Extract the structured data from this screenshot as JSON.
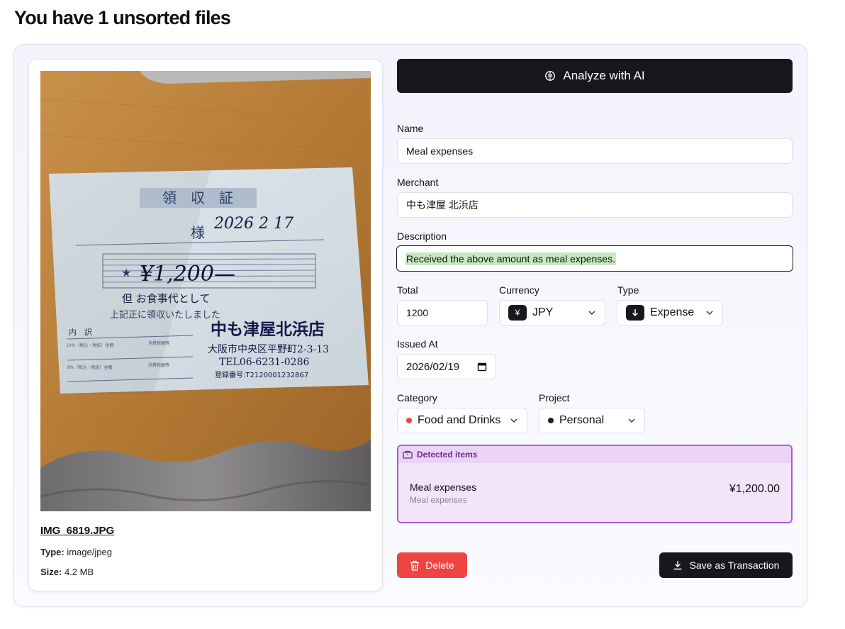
{
  "page": {
    "title": "You have 1 unsorted files"
  },
  "file": {
    "name": "IMG_6819.JPG",
    "type_label": "Type:",
    "type_value": "image/jpeg",
    "size_label": "Size:",
    "size_value": "4.2 MB"
  },
  "actions": {
    "analyze_label": "Analyze with AI",
    "delete_label": "Delete",
    "save_label": "Save as Transaction"
  },
  "form": {
    "name": {
      "label": "Name",
      "value": "Meal expenses"
    },
    "merchant": {
      "label": "Merchant",
      "value": "中も津屋 北浜店"
    },
    "description": {
      "label": "Description",
      "value": "Received the above amount as meal expenses."
    },
    "total": {
      "label": "Total",
      "value": "1200"
    },
    "currency": {
      "label": "Currency",
      "value": "JPY",
      "symbol": "¥"
    },
    "type": {
      "label": "Type",
      "value": "Expense",
      "icon": "arrow-down-icon"
    },
    "issued_at": {
      "label": "Issued At",
      "value": "2026/02/19"
    },
    "category": {
      "label": "Category",
      "value": "Food and Drinks",
      "dot_color": "#ef4444"
    },
    "project": {
      "label": "Project",
      "value": "Personal",
      "dot_color": "#222222"
    }
  },
  "detected": {
    "title": "Detected items",
    "items": [
      {
        "name": "Meal expenses",
        "sub": "Meal expenses",
        "amount": "¥1,200.00"
      }
    ]
  },
  "receipt": {
    "title": "領　収　証",
    "honorific": "様",
    "date": "2026 2 17",
    "amount": "¥1,200—",
    "purpose": "但 お食事代として",
    "confirmation": "上記正に領収いたしました",
    "breakdown": "内　訳",
    "tax10": "10%（税込・税抜）金額",
    "tax8": "8%（税込・税抜）金額",
    "tax_header": "消費税額等",
    "shop": "中も津屋北浜店",
    "address": "大阪市中央区平野町2-3-13",
    "tel": "TEL06-6231-0286",
    "reg": "登録番号:T2120001232867"
  }
}
